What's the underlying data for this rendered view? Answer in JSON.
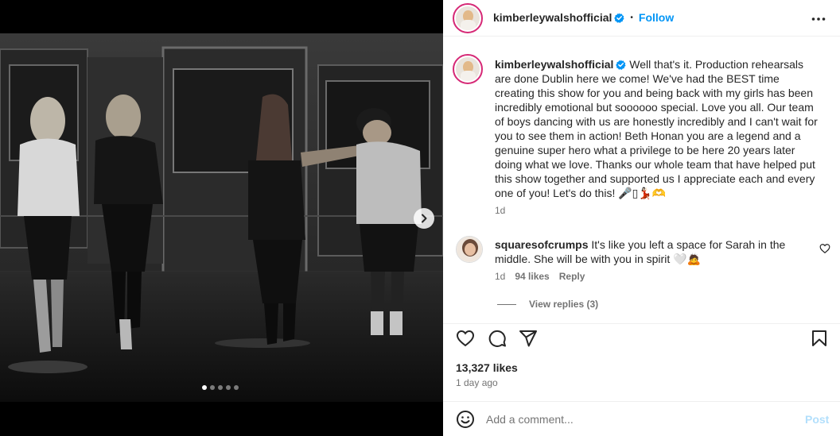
{
  "post": {
    "username": "kimberleywalshofficial",
    "follow_label": "Follow",
    "header_dot": "•",
    "caption": "Well that's it. Production rehearsals are done Dublin here we come! We've had the BEST time creating this show for you and being back with my girls has been incredibly emotional but soooooo special. Love you all. Our team of boys dancing with us are honestly incredibly and I can't wait for you to see them in action! Beth Honan you are a legend and a genuine super hero what a privilege to be here 20 years later doing what we love. Thanks our whole team that have helped put this show together and supported us I appreciate each and every one of you! Let's do this! 🎤▯💃🏻🫶",
    "caption_time": "1d"
  },
  "comment": {
    "username": "squaresofcrumps",
    "text": "It's like you left a space for Sarah in the middle. She will be with you in spirit 🤍🙇",
    "time": "1d",
    "likes": "94 likes",
    "reply_label": "Reply",
    "view_replies": "View replies (3)"
  },
  "stats": {
    "likes": "13,327 likes",
    "time": "1 day ago"
  },
  "composer": {
    "placeholder": "Add a comment...",
    "post_label": "Post"
  },
  "carousel": {
    "slide_count": 5,
    "active_index": 0
  },
  "colors": {
    "accent": "#0095f6",
    "ring": "#d62976",
    "verified": "#0095f6"
  },
  "icons": {
    "more": "more-options-icon",
    "like": "heart-icon",
    "comment": "comment-icon",
    "share": "send-icon",
    "save": "bookmark-icon",
    "emoji": "emoji-icon",
    "next": "chevron-right-icon"
  }
}
